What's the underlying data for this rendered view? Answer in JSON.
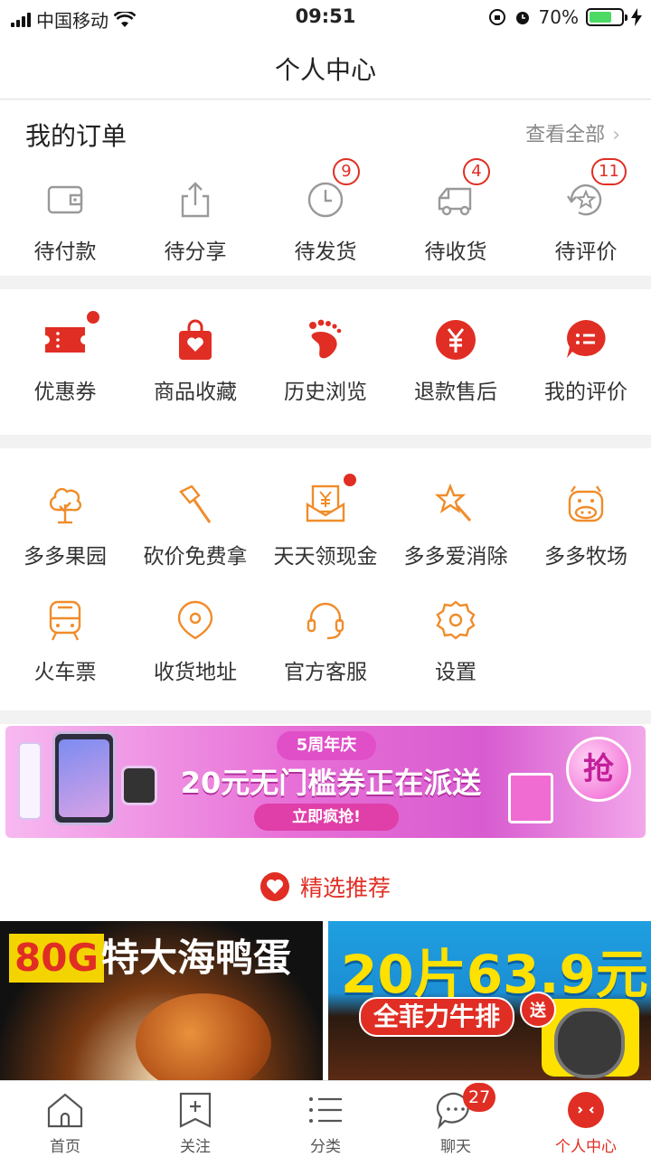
{
  "status_bar": {
    "carrier": "中国移动",
    "time": "09:51",
    "battery_text": "70%",
    "battery_level": 0.7
  },
  "nav": {
    "title": "个人中心"
  },
  "orders": {
    "title": "我的订单",
    "view_all": "查看全部",
    "items": [
      {
        "label": "待付款",
        "icon": "wallet-icon"
      },
      {
        "label": "待分享",
        "icon": "share-icon"
      },
      {
        "label": "待发货",
        "icon": "clock-icon",
        "badge": "9"
      },
      {
        "label": "待收货",
        "icon": "truck-icon",
        "badge": "4"
      },
      {
        "label": "待评价",
        "icon": "review-icon",
        "badge": "11"
      }
    ]
  },
  "tools": {
    "items": [
      {
        "label": "优惠券",
        "icon": "coupon-icon"
      },
      {
        "label": "商品收藏",
        "icon": "favorite-bag-icon"
      },
      {
        "label": "历史浏览",
        "icon": "footprint-icon"
      },
      {
        "label": "退款售后",
        "icon": "refund-icon"
      },
      {
        "label": "我的评价",
        "icon": "comment-icon"
      }
    ]
  },
  "apps": {
    "items": [
      {
        "label": "多多果园",
        "icon": "tree-icon"
      },
      {
        "label": "砍价免费拿",
        "icon": "axe-icon"
      },
      {
        "label": "天天领现金",
        "icon": "cash-icon"
      },
      {
        "label": "多多爱消除",
        "icon": "star-wand-icon"
      },
      {
        "label": "多多牧场",
        "icon": "cow-icon"
      },
      {
        "label": "火车票",
        "icon": "train-icon"
      },
      {
        "label": "收货地址",
        "icon": "location-icon"
      },
      {
        "label": "官方客服",
        "icon": "headset-icon"
      },
      {
        "label": "设置",
        "icon": "settings-icon"
      }
    ]
  },
  "banner": {
    "sub": "5周年庆",
    "main": "20元无门槛券正在派送",
    "button": "立即疯抢!",
    "grab": "抢"
  },
  "recommend": {
    "title": "精选推荐"
  },
  "products": [
    {
      "tag": "80G",
      "text": "特大海鸭蛋"
    },
    {
      "headline": "20片63.9元",
      "sub": "全菲力牛排",
      "gift": "送"
    }
  ],
  "tabbar": {
    "items": [
      {
        "label": "首页",
        "icon": "home-icon"
      },
      {
        "label": "关注",
        "icon": "follow-icon"
      },
      {
        "label": "分类",
        "icon": "category-icon"
      },
      {
        "label": "聊天",
        "icon": "chat-icon",
        "badge": "27"
      },
      {
        "label": "个人中心",
        "icon": "profile-icon"
      }
    ],
    "active_index": 4
  },
  "colors": {
    "brand_red": "#e02e24",
    "orange_icon": "#f08c2a",
    "grey_icon": "#999999"
  }
}
